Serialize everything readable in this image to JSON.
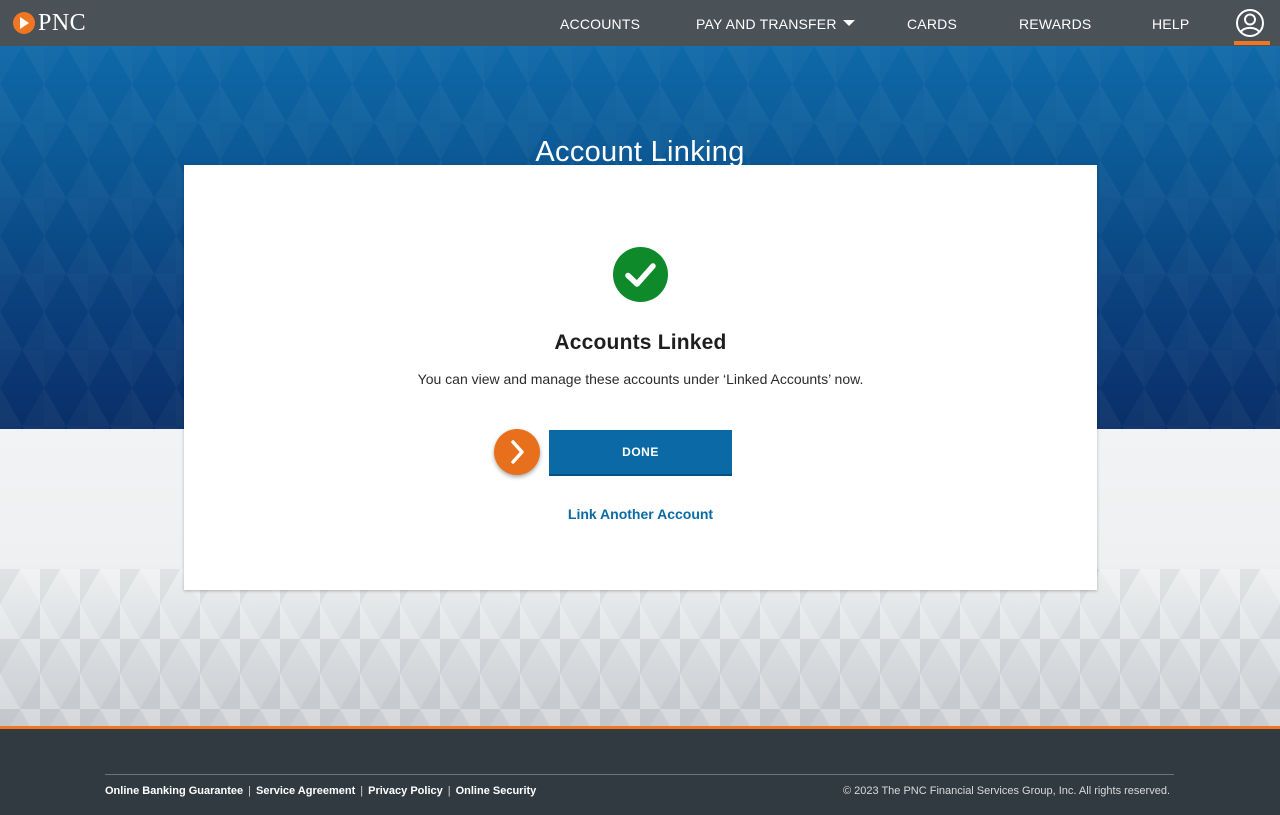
{
  "brand": {
    "name": "PNC",
    "accent_color": "#ef7622",
    "nav_bg": "#4a5157"
  },
  "nav": {
    "items": [
      {
        "label": "ACCOUNTS"
      },
      {
        "label": "PAY AND TRANSFER",
        "has_dropdown": true
      },
      {
        "label": "CARDS"
      },
      {
        "label": "REWARDS"
      },
      {
        "label": "HELP"
      }
    ],
    "profile_icon": "user-circle-icon"
  },
  "page": {
    "title": "Account Linking"
  },
  "card": {
    "status_icon": "check-circle-icon",
    "status_color": "#0f8a2a",
    "heading": "Accounts Linked",
    "message": "You can view and manage these accounts under ‘Linked Accounts’ now.",
    "hint_icon": "chevron-right-icon",
    "done_label": "DONE",
    "link_label": "Link Another Account",
    "button_color": "#0b6aa6"
  },
  "footer": {
    "links": [
      {
        "label": "Online Banking Guarantee"
      },
      {
        "label": "Service Agreement"
      },
      {
        "label": "Privacy Policy"
      },
      {
        "label": "Online Security"
      }
    ],
    "separator": "|",
    "copyright": "© 2023 The PNC Financial Services Group, Inc. All rights reserved."
  }
}
